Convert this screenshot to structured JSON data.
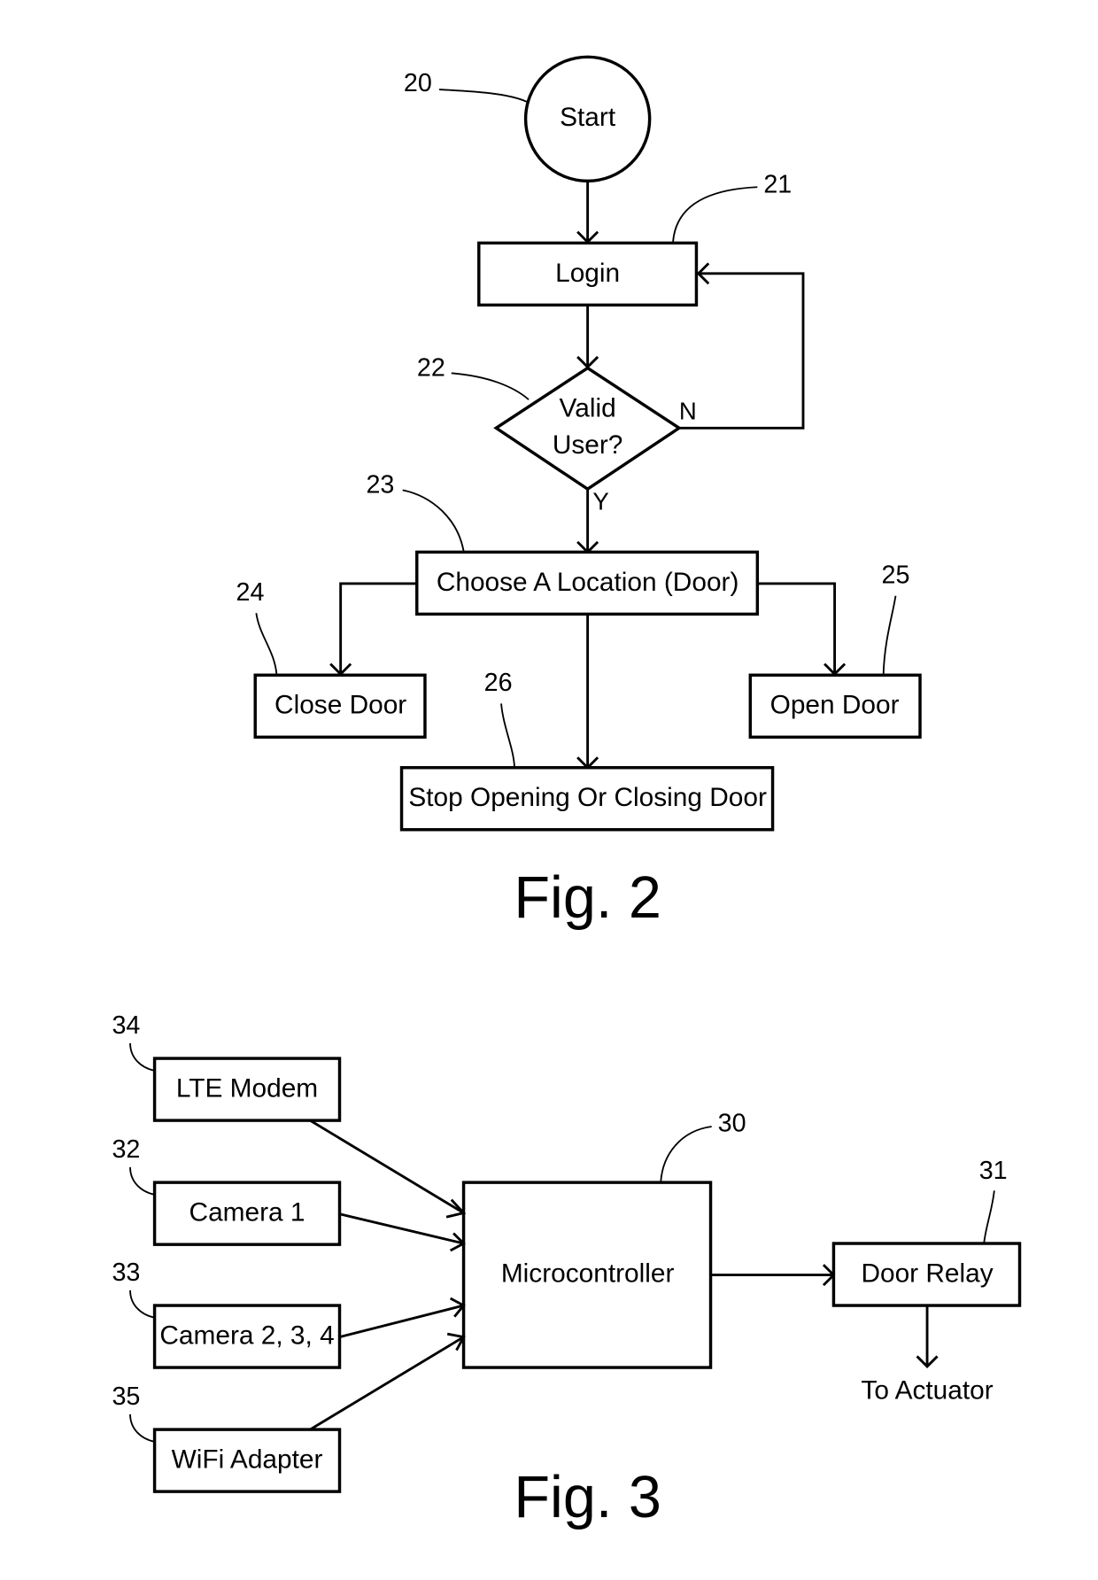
{
  "fig2": {
    "caption": "Fig. 2",
    "nodes": {
      "start": {
        "ref": "20",
        "label": "Start"
      },
      "login": {
        "ref": "21",
        "label": "Login"
      },
      "valid_user": {
        "ref": "22",
        "label_line1": "Valid",
        "label_line2": "User?",
        "yes_label": "Y",
        "no_label": "N"
      },
      "choose_location": {
        "ref": "23",
        "label": "Choose A Location (Door)"
      },
      "close_door": {
        "ref": "24",
        "label": "Close Door"
      },
      "open_door": {
        "ref": "25",
        "label": "Open Door"
      },
      "stop_door": {
        "ref": "26",
        "label": "Stop Opening Or Closing Door"
      }
    }
  },
  "fig3": {
    "caption": "Fig. 3",
    "nodes": {
      "microcontroller": {
        "ref": "30",
        "label": "Microcontroller"
      },
      "door_relay": {
        "ref": "31",
        "label": "Door Relay"
      },
      "camera1": {
        "ref": "32",
        "label": "Camera 1"
      },
      "camera234": {
        "ref": "33",
        "label": "Camera 2, 3, 4"
      },
      "lte_modem": {
        "ref": "34",
        "label": "LTE Modem"
      },
      "wifi_adapter": {
        "ref": "35",
        "label": "WiFi Adapter"
      },
      "actuator_output": {
        "label": "To Actuator"
      }
    }
  }
}
